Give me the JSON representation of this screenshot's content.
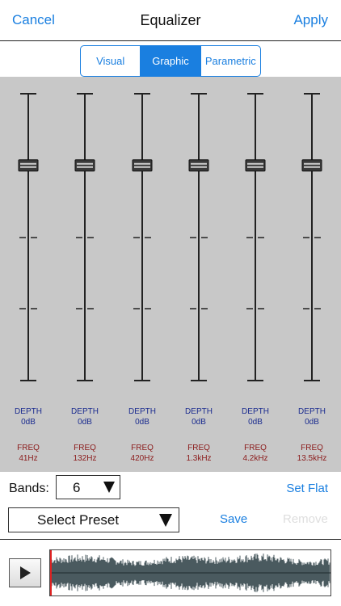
{
  "nav": {
    "cancel": "Cancel",
    "title": "Equalizer",
    "apply": "Apply"
  },
  "tabs": [
    {
      "label": "Visual",
      "active": false
    },
    {
      "label": "Graphic",
      "active": true
    },
    {
      "label": "Parametric",
      "active": false
    }
  ],
  "bands": [
    {
      "depth_label": "DEPTH",
      "depth": "0dB",
      "freq_label": "FREQ",
      "freq": "41Hz",
      "gain_db": 0
    },
    {
      "depth_label": "DEPTH",
      "depth": "0dB",
      "freq_label": "FREQ",
      "freq": "132Hz",
      "gain_db": 0
    },
    {
      "depth_label": "DEPTH",
      "depth": "0dB",
      "freq_label": "FREQ",
      "freq": "420Hz",
      "gain_db": 0
    },
    {
      "depth_label": "DEPTH",
      "depth": "0dB",
      "freq_label": "FREQ",
      "freq": "1.3kHz",
      "gain_db": 0
    },
    {
      "depth_label": "DEPTH",
      "depth": "0dB",
      "freq_label": "FREQ",
      "freq": "4.2kHz",
      "gain_db": 0
    },
    {
      "depth_label": "DEPTH",
      "depth": "0dB",
      "freq_label": "FREQ",
      "freq": "13.5kHz",
      "gain_db": 0
    }
  ],
  "controls": {
    "bands_label": "Bands:",
    "bands_value": "6",
    "set_flat": "Set Flat",
    "preset_placeholder": "Select Preset",
    "save": "Save",
    "remove": "Remove"
  },
  "player": {
    "playhead_position": 0
  },
  "colors": {
    "accent": "#1a7fe0",
    "depth_text": "#1b2c8f",
    "freq_text": "#8b1a1a",
    "waveform": "#4a5a5f",
    "playhead": "#dd2222"
  }
}
